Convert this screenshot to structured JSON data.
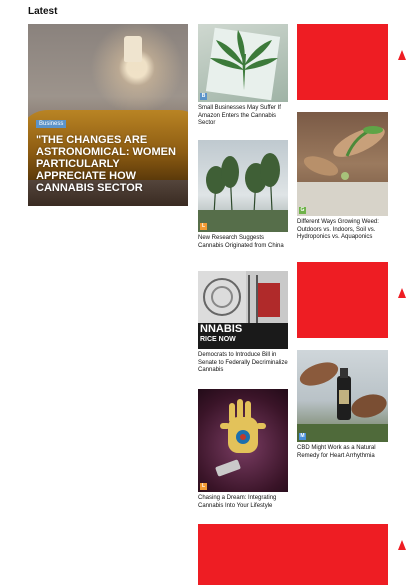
{
  "section": {
    "title": "Latest"
  },
  "featured": {
    "category": "Business",
    "headline": "\"THE CHANGES ARE ASTRONOMICAL: WOMEN PARTICULARLY APPRECIATE HOW CANNABIS SECTOR"
  },
  "articles": [
    {
      "title": "Small Businesses May Suffer If Amazon Enters the Cannabis Sector",
      "category_letter": "B",
      "category_color": "#5b93c9"
    },
    {
      "title": "Different Ways Growing Weed: Outdoors vs. Indoors, Soil vs. Hydroponics vs. Aquaponics",
      "category_letter": "G",
      "category_color": "#6fb24a"
    },
    {
      "title": "New Research Suggests Cannabis Originated from China",
      "category_letter": "L",
      "category_color": "#f29b34"
    },
    {
      "title": "Democrats to Introduce Bill in Senate to Federally Decriminalize Cannabis",
      "category_letter": "",
      "category_color": "#5b93c9"
    },
    {
      "title": "CBD Might Work as a Natural Remedy for Heart Arrhythmia",
      "category_letter": "M",
      "category_color": "#4a90d9"
    },
    {
      "title": "Chasing a Dream: Integrating Cannabis Into Your Lifestyle",
      "category_letter": "L",
      "category_color": "#f29b34"
    }
  ],
  "poster": {
    "line1": "NNABIS",
    "line2": "RICE NOW"
  },
  "colors": {
    "ad_red": "#ee1d23"
  }
}
